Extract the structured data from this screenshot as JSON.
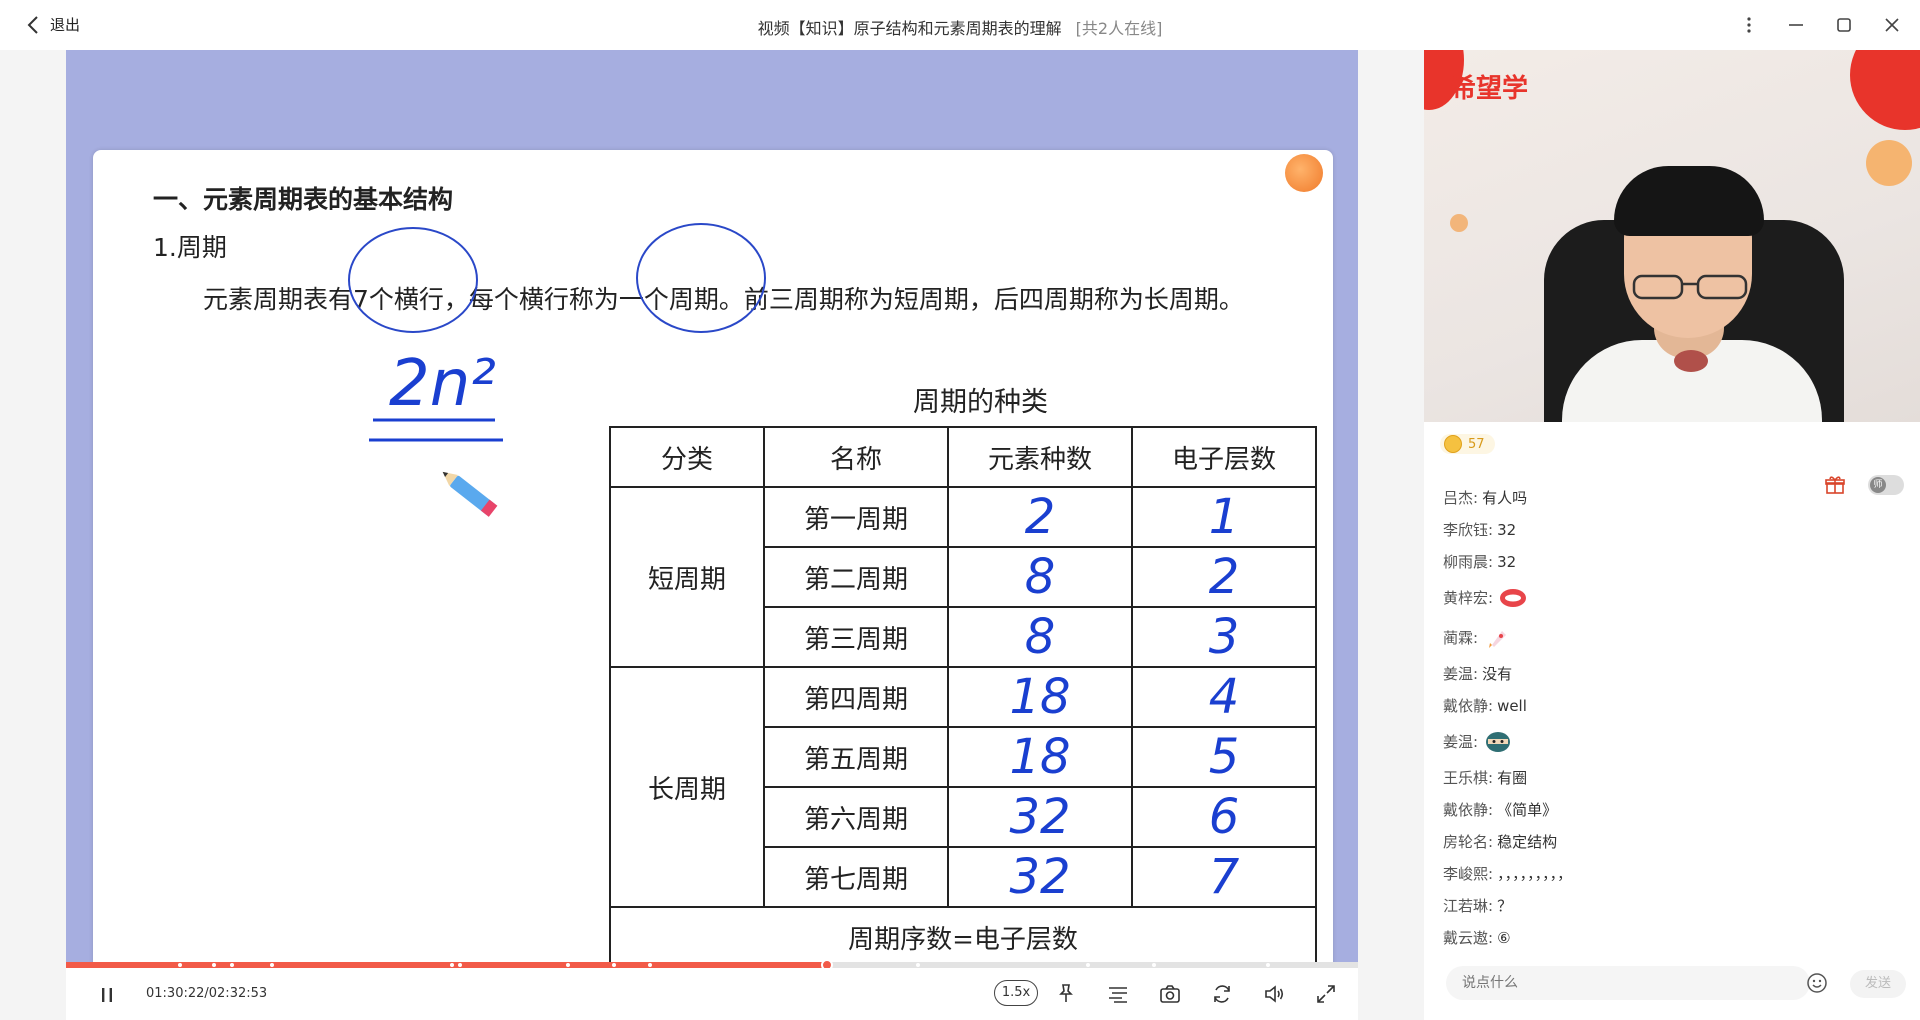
{
  "titlebar": {
    "back_label": "退出",
    "title": "视频【知识】原子结构和元素周期表的理解",
    "online": "[共2人在线]"
  },
  "slide": {
    "heading": "一、元素周期表的基本结构",
    "subheading": "1.周期",
    "paragraph": "元素周期表有7个横行，每个横行称为一个周期。前三周期称为短周期，后四周期称为长周期。",
    "handwriting_formula": "2n²",
    "table_title": "周期的种类",
    "table": {
      "headers": [
        "分类",
        "名称",
        "元素种数",
        "电子层数"
      ],
      "groups": [
        {
          "label": "短周期",
          "rows": [
            {
              "name": "第一周期",
              "count": "2",
              "layers": "1"
            },
            {
              "name": "第二周期",
              "count": "8",
              "layers": "2"
            },
            {
              "name": "第三周期",
              "count": "8",
              "layers": "3"
            }
          ]
        },
        {
          "label": "长周期",
          "rows": [
            {
              "name": "第四周期",
              "count": "18",
              "layers": "4"
            },
            {
              "name": "第五周期",
              "count": "18",
              "layers": "5"
            },
            {
              "name": "第六周期",
              "count": "32",
              "layers": "6"
            },
            {
              "name": "第七周期",
              "count": "32",
              "layers": "7"
            }
          ]
        }
      ],
      "footer": "周期序数=电子层数"
    }
  },
  "player": {
    "time": "01:30:22/02:32:53",
    "speed": "1.5x",
    "progress": 0.589
  },
  "camera": {
    "brand": "希望学"
  },
  "coins": "57",
  "teacher_toggle_label": "师",
  "chat": [
    {
      "user": "吕杰:",
      "text": "有人吗"
    },
    {
      "user": "李欣钰:",
      "text": "32"
    },
    {
      "user": "柳雨晨:",
      "text": "32"
    },
    {
      "user": "黄梓宏:",
      "text": "",
      "emoji": "lips-emoji"
    },
    {
      "user": "蔺霖:",
      "text": "",
      "emoji": "rocket-emoji"
    },
    {
      "user": "姜温:",
      "text": "没有"
    },
    {
      "user": "戴依静:",
      "text": "well"
    },
    {
      "user": "姜温:",
      "text": "",
      "emoji": "ninja-emoji"
    },
    {
      "user": "王乐棋:",
      "text": "有圈"
    },
    {
      "user": "戴依静:",
      "text": "《简单》"
    },
    {
      "user": "房轮名:",
      "text": "稳定结构"
    },
    {
      "user": "李峻熙:",
      "text": "，，，，，，，，，"
    },
    {
      "user": "江若琳:",
      "text": "？"
    },
    {
      "user": "戴云遨:",
      "text": "⑥"
    }
  ],
  "chat_input": {
    "placeholder": "说点什么",
    "send_label": "发送"
  },
  "colors": {
    "video_bg": "#a6aee0",
    "progress": "#f25a48",
    "ink_blue": "#1a3fd0",
    "brand_red": "#e8342b"
  }
}
